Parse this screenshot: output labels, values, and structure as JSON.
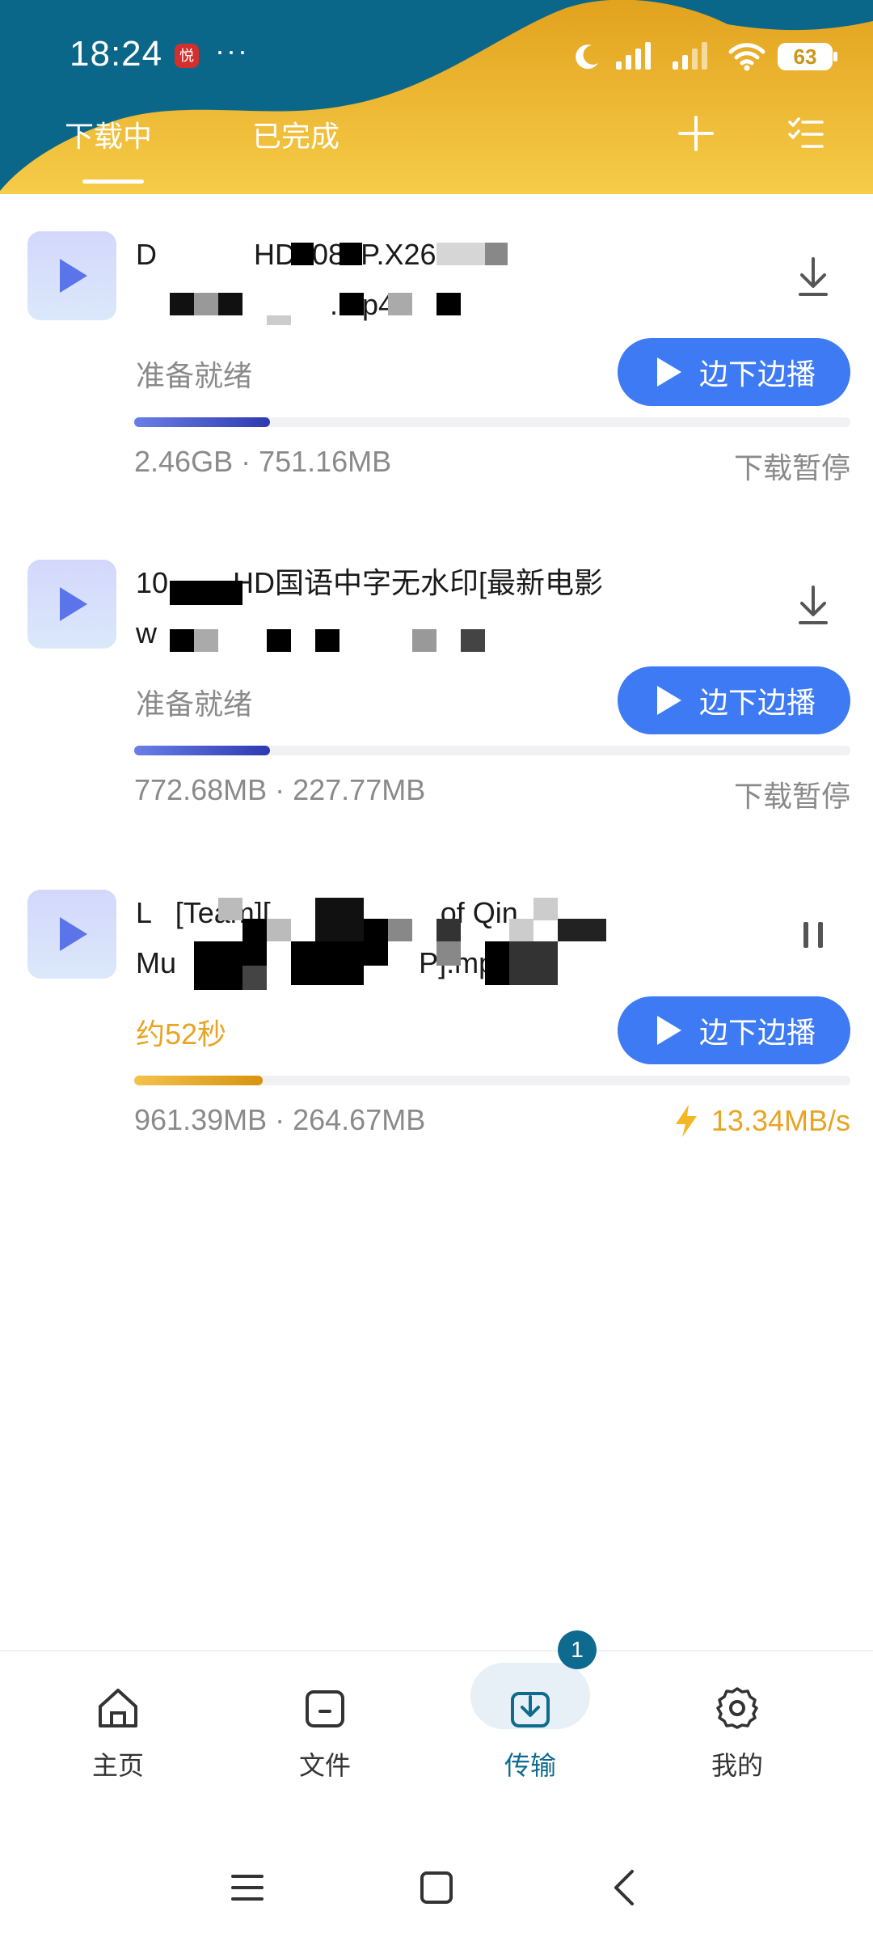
{
  "statusbar": {
    "time": "18:24",
    "notif_app": "悦",
    "more": "···",
    "battery": "63"
  },
  "tabs": {
    "downloading": "下载中",
    "completed": "已完成"
  },
  "items": [
    {
      "title": "D            HD1080P.X264.\n                        .mp4",
      "state": "准备就绪",
      "play_label": "边下边播",
      "progress_fraction": 0.19,
      "sizes": "2.46GB · 751.16MB",
      "right": "下载暂停",
      "status": "paused"
    },
    {
      "title": "10       .HD国语中字无水印[最新电影\nw",
      "state": "准备就绪",
      "play_label": "边下边播",
      "progress_fraction": 0.19,
      "sizes": "772.68MB · 227.77MB",
      "right": "下载暂停",
      "status": "paused"
    },
    {
      "title": "L   [Team][                     of Qin\nMu                              P].mp4",
      "state": "约52秒",
      "play_label": "边下边播",
      "progress_fraction": 0.18,
      "sizes": "961.39MB · 264.67MB",
      "right": "13.34MB/s",
      "status": "downloading"
    }
  ],
  "bottom_nav": [
    {
      "label": "主页",
      "icon": "home-icon"
    },
    {
      "label": "文件",
      "icon": "folder-icon"
    },
    {
      "label": "传输",
      "icon": "download-tray-icon",
      "badge": "1",
      "active": true
    },
    {
      "label": "我的",
      "icon": "gear-icon"
    }
  ],
  "colors": {
    "header_dark": "#0e6a8e",
    "header_gold": "#f0bd3a",
    "accent_blue": "#3e7af3",
    "orange": "#e8a423"
  }
}
